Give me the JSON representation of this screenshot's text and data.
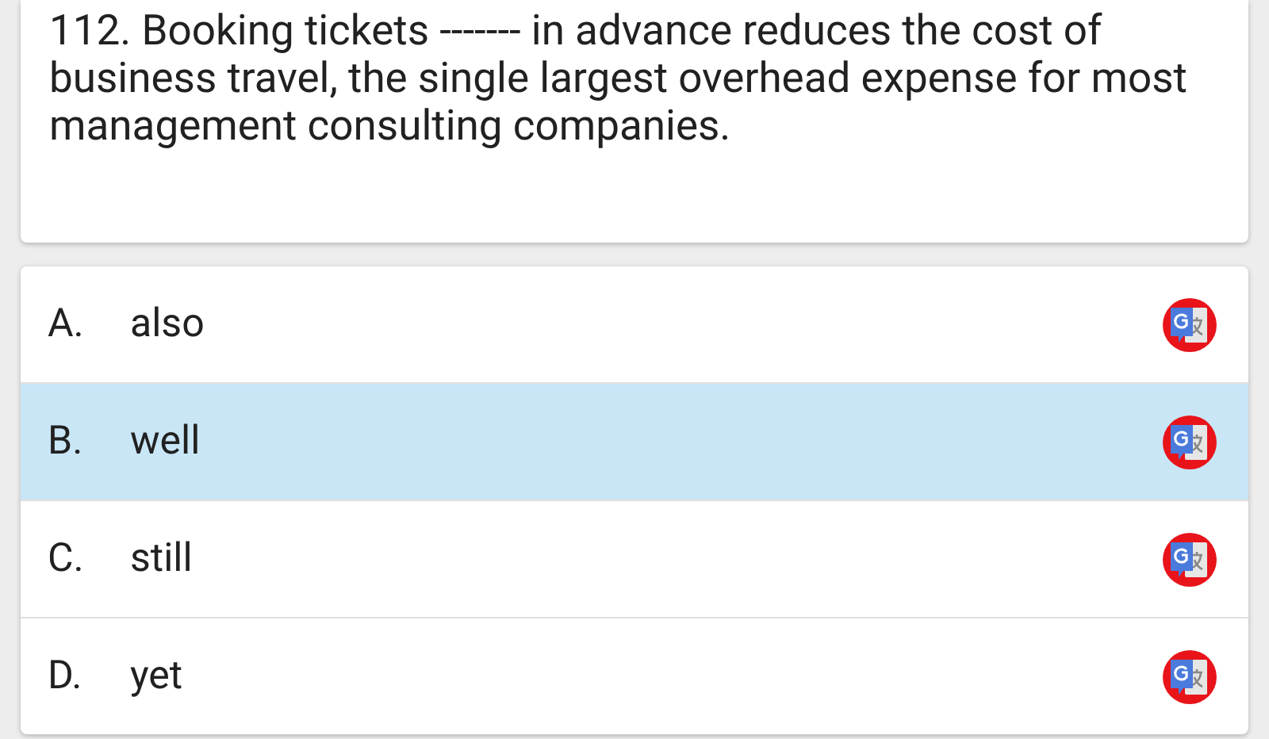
{
  "question": {
    "text": "112. Booking tickets ------- in advance reduces the cost of business travel, the single largest overhead expense for most management consulting companies."
  },
  "options": [
    {
      "letter": "A.",
      "text": "also",
      "selected": false
    },
    {
      "letter": "B.",
      "text": "well",
      "selected": true
    },
    {
      "letter": "C.",
      "text": "still",
      "selected": false
    },
    {
      "letter": "D.",
      "text": "yet",
      "selected": false
    }
  ]
}
